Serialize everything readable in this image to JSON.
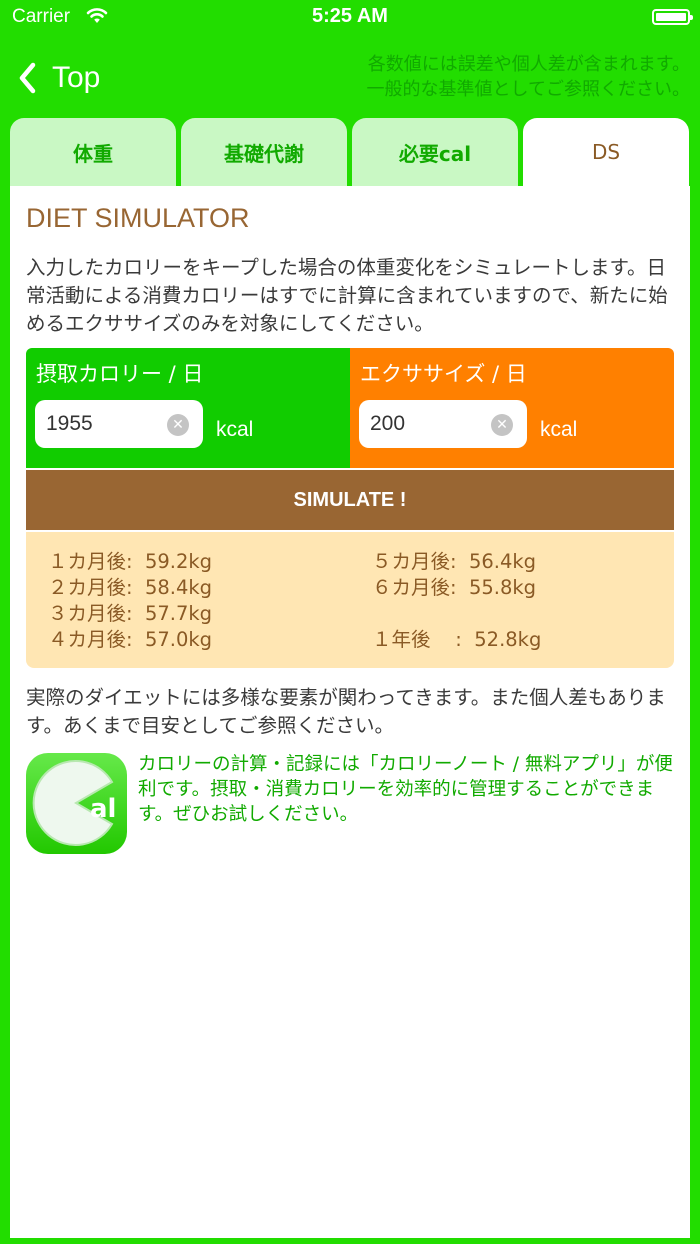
{
  "status": {
    "carrier": "Carrier",
    "time": "5:25 AM"
  },
  "nav": {
    "back_label": "Top",
    "disclaimer_line1": "各数値には誤差や個人差が含まれます。",
    "disclaimer_line2": "一般的な基準値としてご参照ください。"
  },
  "tabs": [
    "体重",
    "基礎代謝",
    "必要cal",
    "DS"
  ],
  "page": {
    "title": "DIET SIMULATOR",
    "intro": "入力したカロリーをキープした場合の体重変化をシミュレートします。日常活動による消費カロリーはすでに計算に含まれていますので、新たに始めるエクササイズのみを対象にしてください。"
  },
  "intake": {
    "label": "摂取カロリー / 日",
    "value": "1955",
    "unit": "kcal"
  },
  "exercise": {
    "label": "エクササイズ / 日",
    "value": "200",
    "unit": "kcal"
  },
  "simulate_label": "SIMULATE !",
  "results": {
    "m1": "１カ月後:  59.2kg",
    "m2": "２カ月後:  58.4kg",
    "m3": "３カ月後:  57.7kg",
    "m4": "４カ月後:  57.0kg",
    "m5": "５カ月後:  56.4kg",
    "m6": "６カ月後:  55.8kg",
    "y1": "１年後    :  52.8kg"
  },
  "note": "実際のダイエットには多様な要素が関わってきます。また個人差もあります。あくまで目安としてご参照ください。",
  "promo": {
    "text": "カロリーの計算・記録には「カロリーノート / 無料アプリ」が便利です。摂取・消費カロリーを効率的に管理することができます。ぜひお試しください。",
    "icon_letters": "al"
  },
  "colors": {
    "background": "#22dd00",
    "intake": "#11cc00",
    "exercise": "#ff8000",
    "simulate": "#996633",
    "results_bg": "#ffe6b3",
    "tab_inactive": "#c9f8c4"
  }
}
